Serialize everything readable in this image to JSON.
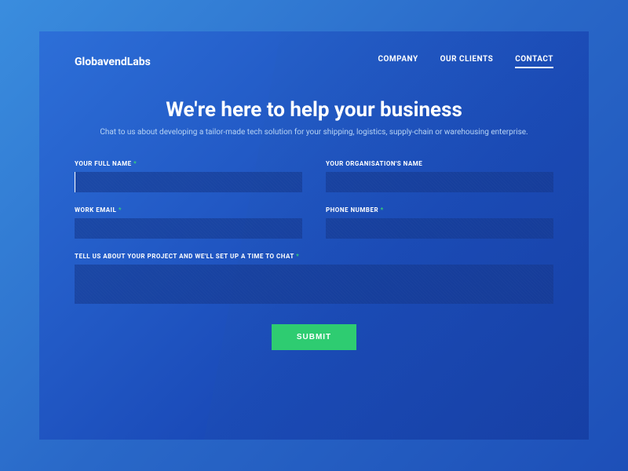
{
  "brand": "GlobavendLabs",
  "nav": {
    "items": [
      "COMPANY",
      "OUR CLIENTS",
      "CONTACT"
    ],
    "activeIndex": 2
  },
  "hero": {
    "title": "We're here to help your business",
    "subtitle": "Chat to us about developing a tailor-made tech solution for your shipping, logistics, supply-chain or warehousing enterprise."
  },
  "form": {
    "fullName": {
      "label": "YOUR FULL NAME",
      "required": true,
      "value": ""
    },
    "orgName": {
      "label": "YOUR ORGANISATION'S NAME",
      "required": false,
      "value": ""
    },
    "email": {
      "label": "WORK EMAIL",
      "required": true,
      "value": ""
    },
    "phone": {
      "label": "PHONE NUMBER",
      "required": true,
      "value": ""
    },
    "project": {
      "label": "TELL US ABOUT YOUR PROJECT AND WE'LL SET UP A TIME TO CHAT",
      "required": true,
      "value": ""
    },
    "submitLabel": "SUBMIT"
  },
  "colors": {
    "accent": "#2ecc71",
    "brandBg": "#1a4ab8"
  }
}
